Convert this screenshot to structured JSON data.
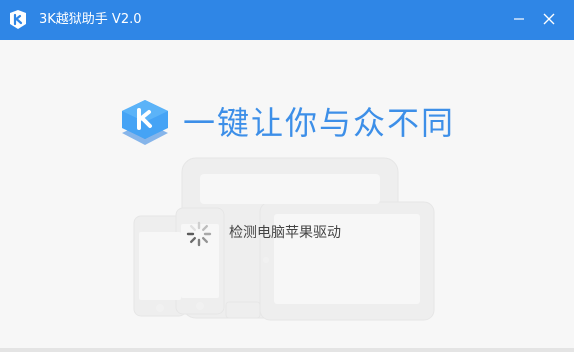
{
  "window": {
    "title": "3K越狱助手 V2.0",
    "app_icon": "3k-logo-icon",
    "minimize_icon": "minimize-icon",
    "close_icon": "close-icon",
    "accent_color": "#2f86e6"
  },
  "main": {
    "logo_icon": "3k-stacked-logo-icon",
    "slogan": "一键让你与众不同",
    "status_text": "检测电脑苹果驱动",
    "spinner_icon": "loading-spinner-icon",
    "slogan_color": "#3d8fe8"
  }
}
